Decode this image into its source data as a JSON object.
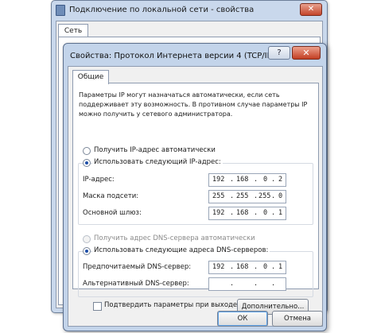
{
  "background_window": {
    "title": "Подключение по локальной сети - свойства",
    "close_glyph": "✕",
    "tab": "Сеть"
  },
  "dialog": {
    "title": "Свойства: Протокол Интернета версии 4 (TCP/IPv4)",
    "help_glyph": "?",
    "close_glyph": "✕",
    "tab": "Общие",
    "description": "Параметры IP могут назначаться автоматически, если сеть поддерживает эту возможность. В противном случае параметры IP можно получить у сетевого администратора.",
    "ip_section": {
      "auto_label": "Получить IP-адрес автоматически",
      "manual_label": "Использовать следующий IP-адрес:",
      "selected": "manual",
      "fields": [
        {
          "label": "IP-адрес:",
          "octets": [
            "192",
            "168",
            "0",
            "2"
          ]
        },
        {
          "label": "Маска подсети:",
          "octets": [
            "255",
            "255",
            "255",
            "0"
          ]
        },
        {
          "label": "Основной шлюз:",
          "octets": [
            "192",
            "168",
            "0",
            "1"
          ]
        }
      ]
    },
    "dns_section": {
      "auto_label": "Получить адрес DNS-сервера автоматически",
      "manual_label": "Использовать следующие адреса DNS-серверов:",
      "selected": "manual",
      "fields": [
        {
          "label": "Предпочитаемый DNS-сервер:",
          "octets": [
            "192",
            "168",
            "0",
            "1"
          ]
        },
        {
          "label": "Альтернативный DNS-сервер:",
          "octets": [
            "",
            "",
            "",
            ""
          ]
        }
      ]
    },
    "validate_label": "Подтвердить параметры при выходе",
    "validate_checked": false,
    "advanced_button": "Дополнительно...",
    "ok_button": "ОК",
    "cancel_button": "Отмена",
    "ip_separator": "."
  }
}
